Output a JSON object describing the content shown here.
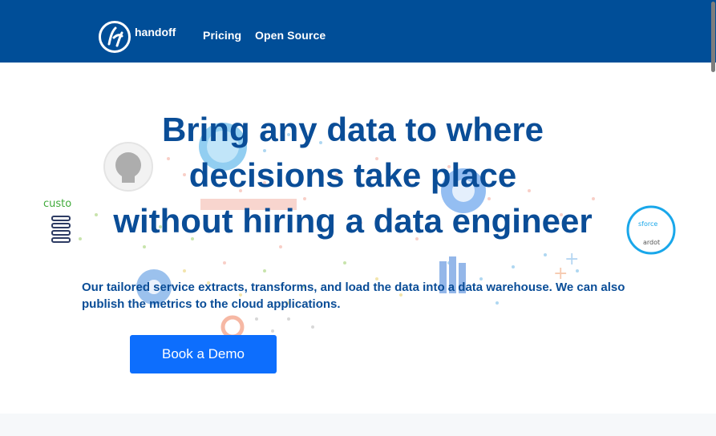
{
  "brand": {
    "logo_icon": "handoff-logo-icon",
    "name": "handoff",
    "primary_color": "#004e98",
    "accent_color": "#0d6efd",
    "text_color": "#0a4d97"
  },
  "nav": {
    "items": [
      {
        "label": "Pricing"
      },
      {
        "label": "Open Source"
      }
    ]
  },
  "hero": {
    "headline": [
      "Bring any data to where",
      "decisions take place",
      "without hiring a data engineer"
    ],
    "subtext": "Our tailored service extracts, transforms, and load the data into a data warehouse. We can also publish the metrics to the cloud applications.",
    "cta_label": "Book a Demo",
    "background_icons": [
      "github-icon",
      "database-server-icon",
      "salesforce-pardot-icon",
      "settings-gear-icon",
      "bar-chart-icon"
    ],
    "background_fragments": [
      "custo",
      "sforce",
      "ardot"
    ]
  }
}
